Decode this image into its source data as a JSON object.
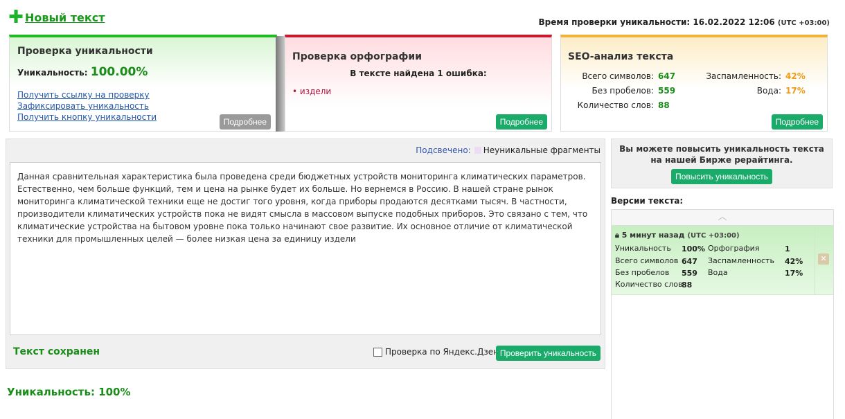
{
  "header": {
    "new_text_label": "Новый текст",
    "check_time_label": "Время проверки уникальности: 16.02.2022 12:06",
    "check_time_tz": "(UTC +03:00)"
  },
  "uniqueness_card": {
    "title": "Проверка уникальности",
    "uniqueness_label": "Уникальность:",
    "uniqueness_value": "100.00%",
    "links": [
      "Получить ссылку на проверку",
      "Зафиксировать уникальность",
      "Получить кнопку уникальности"
    ],
    "more_label": "Подробнее",
    "accent": "#1fba20"
  },
  "spelling_card": {
    "title": "Проверка орфографии",
    "found_text": "В тексте найдена 1 ошибка:",
    "errors": [
      "• издели"
    ],
    "more_label": "Подробнее",
    "accent": "#c8192e"
  },
  "seo_card": {
    "title": "SEO-анализ текста",
    "total_chars_label": "Всего символов:",
    "total_chars": "647",
    "no_spaces_label": "Без пробелов:",
    "no_spaces": "559",
    "word_count_label": "Количество слов:",
    "word_count": "88",
    "spam_label": "Заспамленность:",
    "spam": "42%",
    "water_label": "Вода:",
    "water": "17%",
    "more_label": "Подробнее",
    "accent": "#f0b23c"
  },
  "editor": {
    "highlighted_label": "Подсвечено:",
    "legend_label": "Неуникальные фрагменты",
    "text": "Данная сравнительная характеристика была проведена среди бюджетных устройств мониторинга климатических параметров. Естественно, чем больше функций, тем и цена на рынке будет их больше. Но вернемся в Россию. В нашей стране рынок мониторинга климатической техники еще не достиг того уровня, когда приборы продаются десятками тысяч. В частности, производители климатических устройств пока не видят смысла в массовом выпуске подобных приборов. Это связано с тем, что климатические устройства на бытовом уровне пока только начинают свое развитие. Их основное отличие от климатической техники для промышленных целей — более низкая цена за единицу издели",
    "saved_label": "Текст сохранен",
    "yandex_label": "Проверка по Яндекс.Дзен",
    "check_button": "Проверить уникальность"
  },
  "bottom": {
    "uniqueness": "Уникальность: 100%"
  },
  "promo": {
    "text": "Вы можете повысить уникальность текста на нашей Бирже рерайтинга.",
    "button": "Повысить уникальность"
  },
  "versions": {
    "title": "Версии текста:",
    "items": [
      {
        "time": "5 минут назад",
        "tz": "(UTC +03:00)",
        "uniq_label": "Уникальность",
        "uniq": "100%",
        "spelling_label": "Орфография",
        "spelling": "1",
        "total_label": "Всего символов",
        "total": "647",
        "spam_label": "Заспамленность",
        "spam": "42%",
        "nospace_label": "Без пробелов",
        "nospace": "559",
        "water_label": "Вода",
        "water": "17%",
        "words_label": "Количество слов",
        "words": "88"
      }
    ]
  }
}
